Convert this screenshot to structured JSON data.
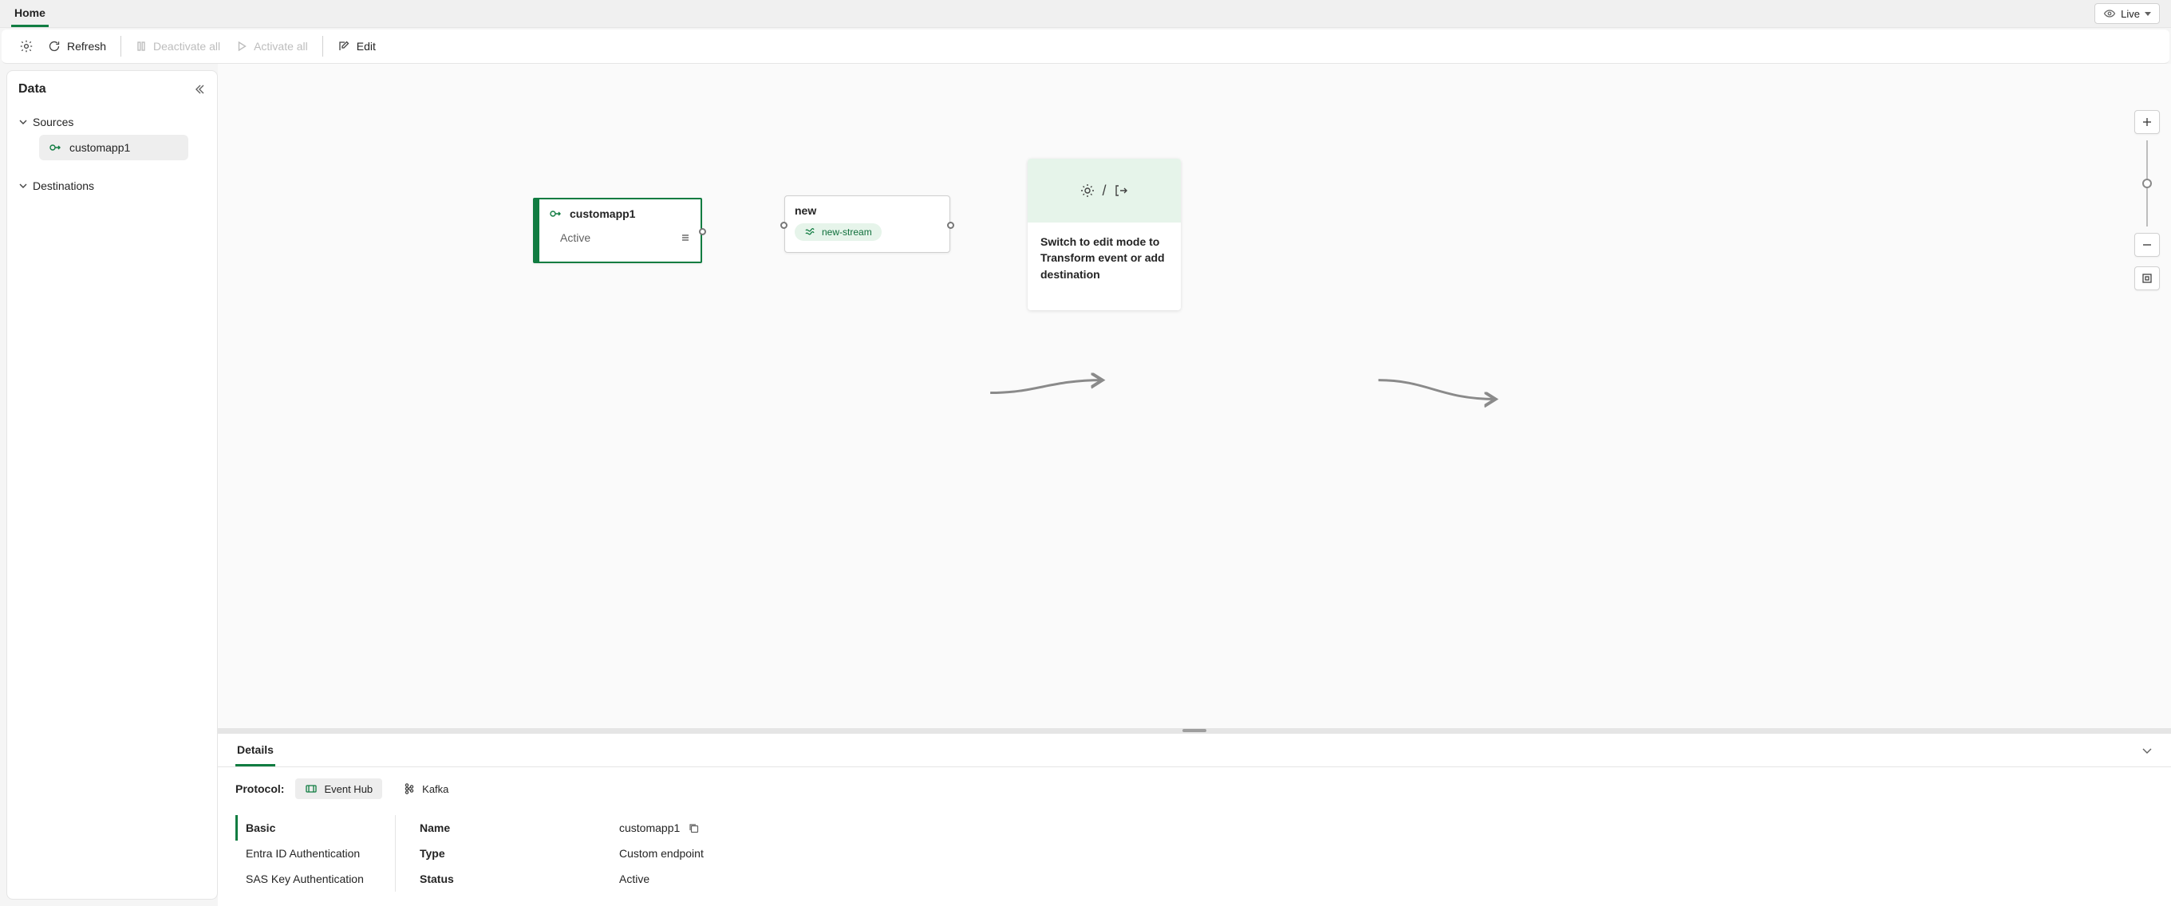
{
  "topnav": {
    "home": "Home",
    "live": "Live"
  },
  "toolbar": {
    "refresh": "Refresh",
    "deactivate_all": "Deactivate all",
    "activate_all": "Activate all",
    "edit": "Edit"
  },
  "sidebar": {
    "title": "Data",
    "sources_label": "Sources",
    "destinations_label": "Destinations",
    "items": [
      {
        "label": "customapp1"
      }
    ]
  },
  "canvas": {
    "source_node": {
      "title": "customapp1",
      "status": "Active"
    },
    "new_node": {
      "title": "new",
      "stream": "new-stream"
    },
    "dest_node": {
      "text": "Switch to edit mode to Transform event or add destination"
    }
  },
  "details": {
    "tab": "Details",
    "protocol_label": "Protocol:",
    "protocols": {
      "eventhub": "Event Hub",
      "kafka": "Kafka"
    },
    "nav": {
      "basic": "Basic",
      "entra": "Entra ID Authentication",
      "sas": "SAS Key Authentication"
    },
    "fields": {
      "name_key": "Name",
      "name_val": "customapp1",
      "type_key": "Type",
      "type_val": "Custom endpoint",
      "status_key": "Status",
      "status_val": "Active"
    }
  }
}
